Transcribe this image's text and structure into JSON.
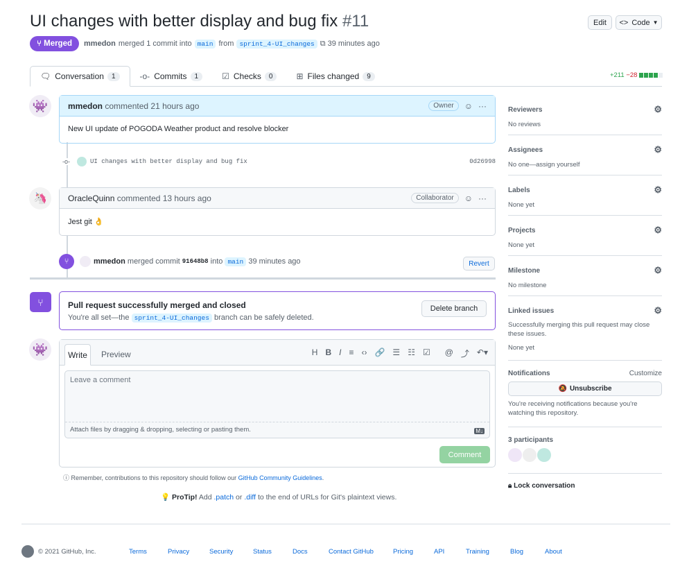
{
  "header": {
    "title": "UI changes with better display and bug fix",
    "number": "#11",
    "edit": "Edit",
    "code": "Code",
    "status": "Merged",
    "author": "mmedon",
    "merged_text": "merged 1 commit into",
    "base": "main",
    "from": "from",
    "head": "sprint_4-UI_changes",
    "time": "39 minutes ago"
  },
  "tabs": [
    {
      "label": "Conversation",
      "count": "1"
    },
    {
      "label": "Commits",
      "count": "1"
    },
    {
      "label": "Checks",
      "count": "0"
    },
    {
      "label": "Files changed",
      "count": "9"
    }
  ],
  "diffstat": {
    "additions": "+211",
    "deletions": "−28"
  },
  "timeline": {
    "c1": {
      "author": "mmedon",
      "action": "commented 21 hours ago",
      "role": "Owner",
      "body": "New UI update of POGODA Weather product and resolve blocker"
    },
    "commit": {
      "message": "UI changes with better display and bug fix",
      "sha": "0d26998"
    },
    "c2": {
      "author": "OracleQuinn",
      "action": "commented 13 hours ago",
      "role": "Collaborator",
      "body": "Jest git 👌"
    },
    "merge": {
      "author": "mmedon",
      "text": "merged commit",
      "sha": "91648b8",
      "into": "into",
      "base": "main",
      "time": "39 minutes ago",
      "revert": "Revert"
    }
  },
  "merged_box": {
    "title": "Pull request successfully merged and closed",
    "pre": "You're all set—the",
    "branch": "sprint_4-UI_changes",
    "post": "branch can be safely deleted.",
    "button": "Delete branch"
  },
  "editor": {
    "write": "Write",
    "preview": "Preview",
    "placeholder": "Leave a comment",
    "attach": "Attach files by dragging & dropping, selecting or pasting them.",
    "submit": "Comment",
    "md": "M↓"
  },
  "remember": {
    "text": "Remember, contributions to this repository should follow our",
    "link": "GitHub Community Guidelines",
    "end": "."
  },
  "protip": {
    "label": "ProTip!",
    "a": "Add",
    "patch": ".patch",
    "or": "or",
    "diff": ".diff",
    "rest": "to the end of URLs for Git's plaintext views."
  },
  "sidebar": {
    "sections": [
      {
        "title": "Reviewers",
        "value": "No reviews"
      },
      {
        "title": "Assignees",
        "value": "No one—assign yourself"
      },
      {
        "title": "Labels",
        "value": "None yet"
      },
      {
        "title": "Projects",
        "value": "None yet"
      },
      {
        "title": "Milestone",
        "value": "No milestone"
      }
    ],
    "linked": {
      "title": "Linked issues",
      "desc": "Successfully merging this pull request may close these issues.",
      "value": "None yet"
    },
    "notifications": {
      "title": "Notifications",
      "customize": "Customize",
      "button": "Unsubscribe",
      "desc": "You're receiving notifications because you're watching this repository."
    },
    "participants": "3 participants",
    "lock": "Lock conversation"
  },
  "footer": {
    "copyright": "© 2021 GitHub, Inc.",
    "links": [
      "Terms",
      "Privacy",
      "Security",
      "Status",
      "Docs",
      "Contact GitHub",
      "Pricing",
      "API",
      "Training",
      "Blog",
      "About"
    ]
  },
  "colors": {
    "merged": "#8250df",
    "green": "#2da44e",
    "red": "#cf222e"
  }
}
